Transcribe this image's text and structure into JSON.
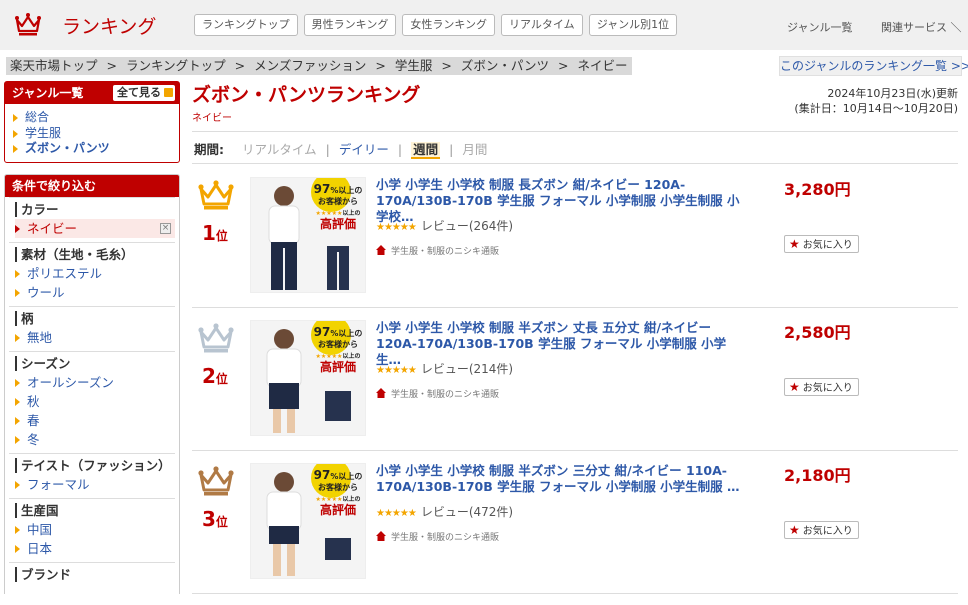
{
  "header": {
    "title": "ランキング",
    "tabs": [
      "ランキングトップ",
      "男性ランキング",
      "女性ランキング",
      "リアルタイム",
      "ジャンル別1位"
    ],
    "genre_list": "ジャンル一覧",
    "related_services": "関連サービス ＼"
  },
  "breadcrumb": [
    "楽天市場トップ",
    "ランキングトップ",
    "メンズファッション",
    "学生服",
    "ズボン・パンツ",
    "ネイビー"
  ],
  "breadcrumb_sep": ">",
  "genre_ranking_link": "このジャンルのランキング一覧 >>",
  "sidebar": {
    "genre_title": "ジャンル一覧",
    "show_all": "全て見る",
    "genres": [
      "総合",
      "学生服",
      "ズボン・パンツ"
    ],
    "filter_title": "条件で絞り込む",
    "filters": [
      {
        "title": "カラー",
        "items": [
          "ネイビー"
        ]
      },
      {
        "title": "素材（生地・毛糸）",
        "items": [
          "ポリエステル",
          "ウール"
        ]
      },
      {
        "title": "柄",
        "items": [
          "無地"
        ]
      },
      {
        "title": "シーズン",
        "items": [
          "オールシーズン",
          "秋",
          "春",
          "冬"
        ]
      },
      {
        "title": "テイスト（ファッション）",
        "items": [
          "フォーマル"
        ]
      },
      {
        "title": "生産国",
        "items": [
          "中国",
          "日本"
        ]
      },
      {
        "title": "ブランド",
        "items": []
      }
    ]
  },
  "main": {
    "title": "ズボン・パンツランキング",
    "subtitle": "ネイビー",
    "updated": "2024年10月23日(水)更新",
    "period_total": "(集計日：10月14日～10月20日)",
    "period_label": "期間:",
    "periods": [
      "リアルタイム",
      "デイリー",
      "週間",
      "月間"
    ]
  },
  "items": [
    {
      "rank": "1",
      "rank_suffix": "位",
      "name": "小学 小学生 小学校 制服 長ズボン 紺/ネイビー 120A-170A/130B-170B 学生服 フォーマル 小学制服 小学生制服 小学校…",
      "stars": "★★★★★",
      "review": "レビュー(264件)",
      "shop": "学生服・制服のニシキ通販",
      "price": "3,280円",
      "fav": "お気に入り"
    },
    {
      "rank": "2",
      "rank_suffix": "位",
      "name": "小学 小学生 小学校 制服 半ズボン 丈長 五分丈 紺/ネイビー 120A-170A/130B-170B 学生服 フォーマル 小学制服 小学生…",
      "stars": "★★★★★",
      "review": "レビュー(214件)",
      "shop": "学生服・制服のニシキ通販",
      "price": "2,580円",
      "fav": "お気に入り"
    },
    {
      "rank": "3",
      "rank_suffix": "位",
      "name": "小学 小学生 小学校 制服 半ズボン 三分丈 紺/ネイビー 110A-170A/130B-170B 学生服 フォーマル 小学制服 小学生制服 …",
      "stars": "★★★★★",
      "review": "レビュー(472件)",
      "shop": "学生服・制服のニシキ通販",
      "price": "2,180円",
      "fav": "お気に入り"
    }
  ],
  "product_badge": {
    "line1": "97",
    "line1b": "%以上の",
    "line2": "お客様から",
    "line3": "★★★★★",
    "line3b": "以上の",
    "line4": "高評価"
  },
  "colors": {
    "brand_red": "#bf0000",
    "link_blue": "#2d58a8",
    "gold": "#f3a500",
    "silver": "#b8c4d0",
    "bronze": "#b07a45"
  }
}
